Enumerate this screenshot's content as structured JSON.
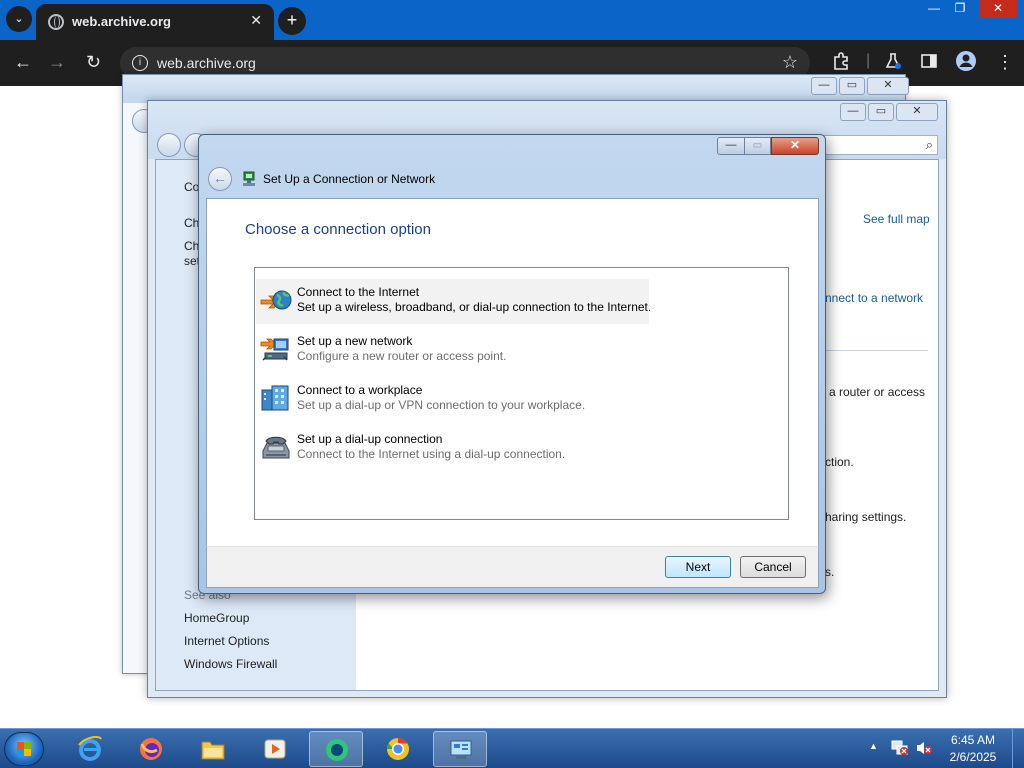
{
  "browser": {
    "tab_title": "web.archive.org",
    "tab_dropdown": "⌄",
    "tab_close": "✕",
    "new_tab": "+",
    "url": "web.archive.org",
    "window_minimize": "—",
    "window_restore": "❐",
    "window_close": "✕",
    "back": "←",
    "forward": "→",
    "reload": "↻"
  },
  "background_window": {
    "left_pane": {
      "partial_1": "Co",
      "partial_2": "Ch",
      "partial_3": "Ch",
      "partial_4": "set",
      "see_also": "See also",
      "links": [
        "HomeGroup",
        "Internet Options",
        "Windows Firewall"
      ]
    },
    "right_pane": {
      "see_full_map": "See full map",
      "connect_to_network": "nnect to a network",
      "router_access": "a router or access",
      "ection": "ction.",
      "sharing": "haring settings.",
      "s": "s."
    }
  },
  "dialog": {
    "title": "Set Up a Connection or Network",
    "heading": "Choose a connection option",
    "options": [
      {
        "title": "Connect to the Internet",
        "description": "Set up a wireless, broadband, or dial-up connection to the Internet.",
        "icon": "globe-network-icon",
        "selected": true
      },
      {
        "title": "Set up a new network",
        "description": "Configure a new router or access point.",
        "icon": "new-network-icon",
        "selected": false
      },
      {
        "title": "Connect to a workplace",
        "description": "Set up a dial-up or VPN connection to your workplace.",
        "icon": "workplace-icon",
        "selected": false
      },
      {
        "title": "Set up a dial-up connection",
        "description": "Connect to the Internet using a dial-up connection.",
        "icon": "phone-modem-icon",
        "selected": false
      }
    ],
    "next_button": "Next",
    "cancel_button": "Cancel",
    "minimize": "—",
    "maximize": "▭",
    "close": "✕"
  },
  "taskbar": {
    "apps": [
      "Internet Explorer",
      "Firefox",
      "Windows Explorer",
      "Media Player",
      "Active App",
      "Chromium",
      "Control Panel"
    ],
    "time": "6:45 AM",
    "date": "2/6/2025"
  },
  "colors": {
    "accent": "#1e3f8a",
    "link": "#1a5ba6",
    "taskbar": "#1d4a8a",
    "chrome_bg": "#1f1f1f",
    "tabstrip": "#0b64c8"
  }
}
